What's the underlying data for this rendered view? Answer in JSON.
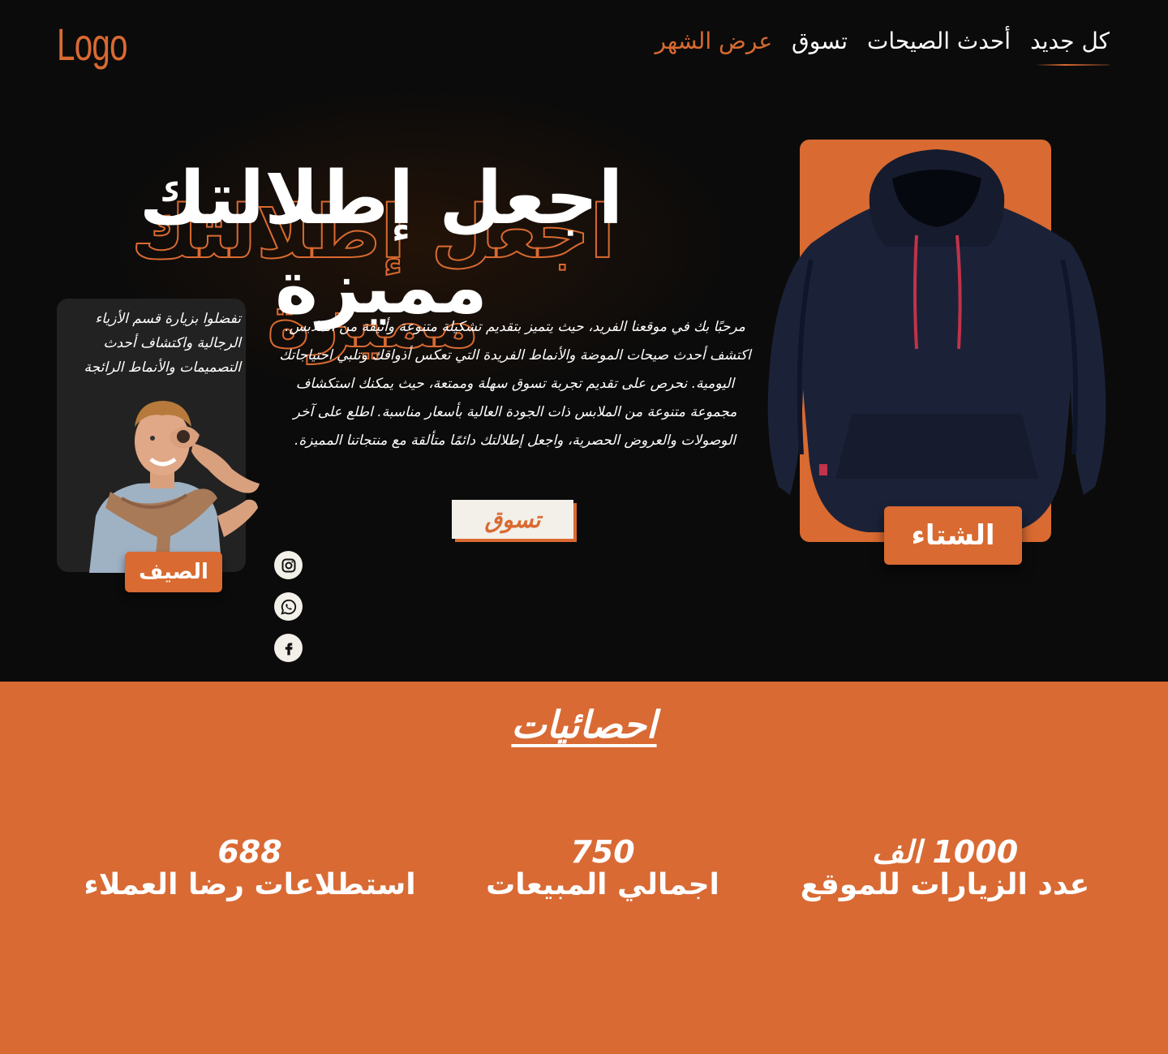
{
  "brand": {
    "logo_text": "Logo"
  },
  "nav": {
    "items": [
      {
        "label": "كل جديد"
      },
      {
        "label": "أحدث الصيحات"
      },
      {
        "label": "تسوق"
      },
      {
        "label": "عرض الشهر"
      }
    ]
  },
  "hero": {
    "headline": "اجعل إطلالتك مميزة",
    "intro": "مرحبًا بك في موقعنا الفريد، حيث يتميز بتقديم تشكيلة متنوعة وأنيقة من الملابس. اكتشف أحدث صيحات الموضة والأنماط الفريدة التي تعكس أذواقك وتلبي احتياجاتك اليومية. نحرص على تقديم تجربة تسوق سهلة وممتعة، حيث يمكنك استكشاف مجموعة متنوعة من الملابس ذات الجودة العالية بأسعار مناسبة. اطلع على آخر الوصولات والعروض الحصرية، واجعل إطلالتك دائمًا متألقة مع منتجاتنا المميزة.",
    "shop_button": "تسوق"
  },
  "summer_card": {
    "text": "تفضلوا بزيارة قسم الأزياء الرجالية واكتشاف أحدث التصميمات والأنماط الرائجة",
    "badge": "الصيف"
  },
  "winter_card": {
    "badge": "الشتاء"
  },
  "socials": [
    "instagram-icon",
    "whatsapp-icon",
    "facebook-icon"
  ],
  "stats": {
    "title": "احصائيات",
    "items": [
      {
        "value": "1000 الف",
        "label": "عدد الزيارات للموقع"
      },
      {
        "value": "750",
        "label": "اجمالي المبيعات"
      },
      {
        "value": "688",
        "label": "استطلاعات رضا العملاء"
      }
    ]
  },
  "colors": {
    "accent": "#d96a31",
    "background": "#0b0b0b",
    "card": "#232222",
    "light": "#f3efe9"
  }
}
